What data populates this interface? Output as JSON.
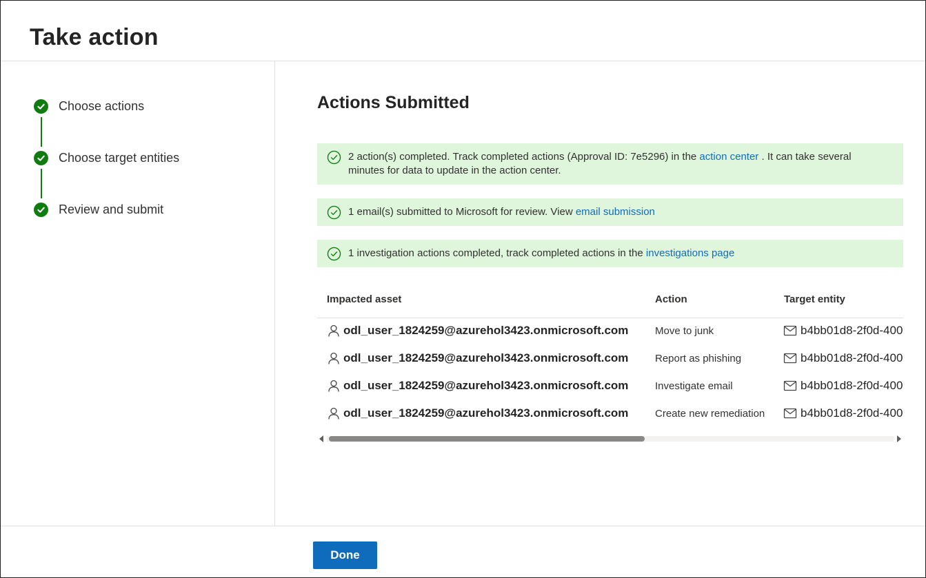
{
  "dialog": {
    "title": "Take action"
  },
  "steps": [
    {
      "label": "Choose actions",
      "status": "completed"
    },
    {
      "label": "Choose target entities",
      "status": "completed"
    },
    {
      "label": "Review and submit",
      "status": "completed"
    }
  ],
  "main": {
    "section_title": "Actions Submitted",
    "banners": [
      {
        "text_before": "2 action(s) completed. Track completed actions (Approval ID: 7e5296) in the ",
        "link": "action center",
        "text_after": " . It can take several minutes for data to update in the action center."
      },
      {
        "text_before": "1 email(s) submitted to Microsoft for review. View ",
        "link": "email submission",
        "text_after": ""
      },
      {
        "text_before": "1 investigation actions completed, track completed actions in the ",
        "link": "investigations page",
        "text_after": ""
      }
    ],
    "table": {
      "columns": [
        "Impacted asset",
        "Action",
        "Target entity"
      ],
      "rows": [
        {
          "asset": "odl_user_1824259@azurehol3423.onmicrosoft.com",
          "action": "Move to junk",
          "target": "b4bb01d8-2f0d-400"
        },
        {
          "asset": "odl_user_1824259@azurehol3423.onmicrosoft.com",
          "action": "Report as phishing",
          "target": "b4bb01d8-2f0d-400"
        },
        {
          "asset": "odl_user_1824259@azurehol3423.onmicrosoft.com",
          "action": "Investigate email",
          "target": "b4bb01d8-2f0d-400"
        },
        {
          "asset": "odl_user_1824259@azurehol3423.onmicrosoft.com",
          "action": "Create new remediation",
          "target": "b4bb01d8-2f0d-400"
        }
      ]
    }
  },
  "footer": {
    "done_label": "Done"
  },
  "icons": {
    "step": "checkmark-circle-filled-icon",
    "banner": "checkmark-circle-outline-icon",
    "asset": "person-icon",
    "target": "mail-icon"
  },
  "colors": {
    "accent": "#0f6cbd",
    "success": "#107c10",
    "success_background": "#dff6dd"
  }
}
